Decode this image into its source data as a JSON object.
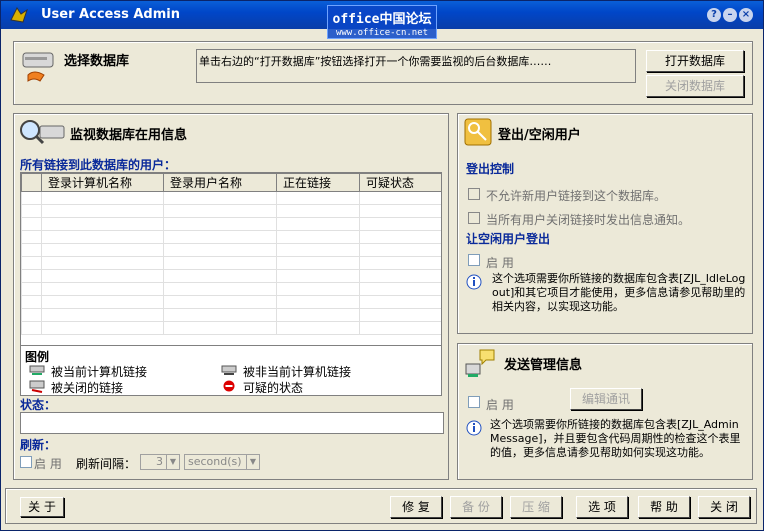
{
  "window": {
    "title": "User Access Admin"
  },
  "watermark": {
    "line1": "office中国论坛",
    "line2": "www.office-cn.net"
  },
  "titlebar_buttons": {
    "help": "?",
    "minimize": "–",
    "close": "×"
  },
  "select_db": {
    "heading": "选择数据库",
    "description": "单击右边的“打开数据库”按钮选择打开一个你需要监视的后台数据库……",
    "open_button": "打开数据库",
    "close_button": "关闭数据库"
  },
  "monitor": {
    "heading": "监视数据库在用信息",
    "users_label": "所有链接到此数据库的用户：",
    "columns": [
      "登录计算机名称",
      "登录用户名称",
      "正在链接",
      "可疑状态"
    ],
    "legend_title": "图例",
    "legend": [
      "被当前计算机链接",
      "被非当前计算机链接",
      "被关闭的链接",
      "可疑的状态"
    ],
    "status_label": "状态：",
    "refresh_label": "刷新：",
    "refresh_enable": "启 用",
    "refresh_interval_label": "刷新间隔：",
    "refresh_value": "3",
    "refresh_unit": "second(s)"
  },
  "logout": {
    "heading": "登出/空闲用户",
    "control_label": "登出控制",
    "option1": "不允许新用户链接到这个数据库。",
    "option2": "当所有用户关闭链接时发出信息通知。",
    "idle_label": "让空闲用户登出",
    "enable": "启 用",
    "info": "这个选项需要你所链接的数据库包含表[ZJL_IdleLogout]和其它项目才能使用，更多信息请参见帮助里的相关内容，以实现这功能。"
  },
  "message": {
    "heading": "发送管理信息",
    "enable": "启 用",
    "edit_button": "编辑通讯",
    "info": "这个选项需要你所链接的数据库包含表[ZJL_AdminMessage]，并且要包含代码周期性的检查这个表里的值，更多信息请参见帮助如何实现这功能。"
  },
  "footer": {
    "about": "关 于",
    "repair": "修 复",
    "backup": "备 份",
    "compact": "压 缩",
    "options": "选 项",
    "help": "帮 助",
    "close": "关 闭"
  }
}
